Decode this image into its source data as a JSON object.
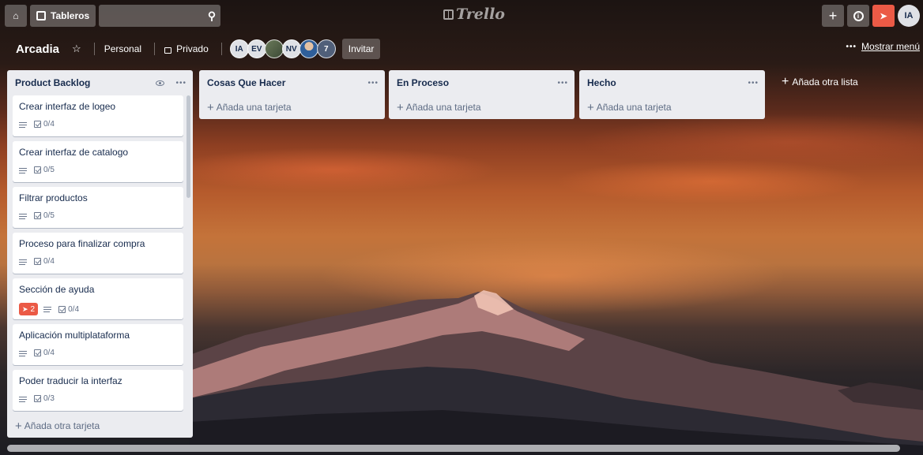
{
  "header": {
    "boards_label": "Tableros",
    "logo_text": "Trello",
    "user_initials": "IA"
  },
  "board": {
    "title": "Arcadia",
    "visibility_team": "Personal",
    "visibility_privacy": "Privado",
    "members": [
      "IA",
      "EV",
      "",
      "NV",
      "",
      "7"
    ],
    "invite_label": "Invitar",
    "show_menu_label": "Mostrar menú"
  },
  "lists": [
    {
      "title": "Product Backlog",
      "cards": [
        {
          "title": "Crear interfaz de logeo",
          "checklist": "0/4"
        },
        {
          "title": "Crear interfaz de catalogo",
          "checklist": "0/5"
        },
        {
          "title": "Filtrar productos",
          "checklist": "0/5"
        },
        {
          "title": "Proceso para finalizar compra",
          "checklist": "0/4"
        },
        {
          "title": "Sección de ayuda",
          "checklist": "0/4",
          "badge": "2"
        },
        {
          "title": "Aplicación multiplataforma",
          "checklist": "0/4"
        },
        {
          "title": "Poder traducir la interfaz",
          "checklist": "0/3"
        }
      ],
      "add_card_label": "Añada otra tarjeta"
    },
    {
      "title": "Cosas Que Hacer",
      "add_card_label": "Añada una tarjeta"
    },
    {
      "title": "En Proceso",
      "add_card_label": "Añada una tarjeta"
    },
    {
      "title": "Hecho",
      "add_card_label": "Añada una tarjeta"
    }
  ],
  "add_list_label": "Añada otra lista",
  "colors": {
    "list_bg": "#ebecf0",
    "card_bg": "#ffffff",
    "badge_red": "#eb5a46",
    "text_dark": "#172b4d",
    "text_muted": "#5e6c84"
  },
  "icons": [
    "home-icon",
    "board-icon",
    "search-icon",
    "plus-icon",
    "info-icon",
    "notification-icon",
    "star-icon",
    "lock-icon",
    "eye-icon",
    "more-icon",
    "description-icon",
    "checklist-icon",
    "rocket-icon"
  ]
}
